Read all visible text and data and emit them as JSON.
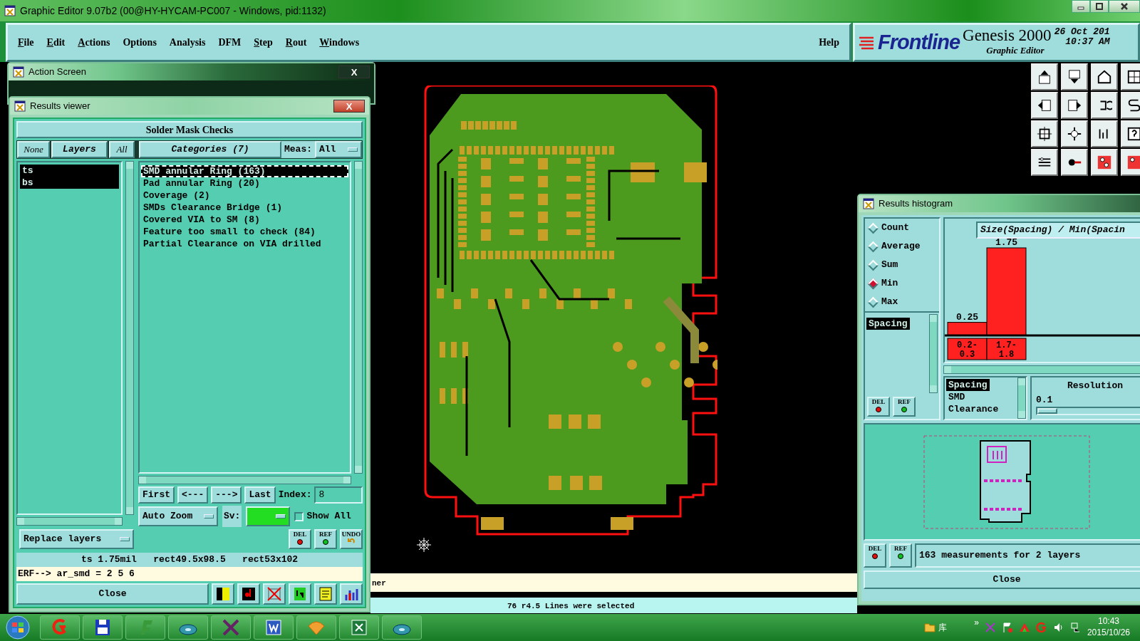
{
  "window": {
    "title": "Graphic Editor 9.07b2 (00@HY-HYCAM-PC007 - Windows, pid:1132)"
  },
  "menu": [
    {
      "label": "File",
      "underlined": true
    },
    {
      "label": "Edit",
      "underlined": true
    },
    {
      "label": "Actions",
      "underlined": true
    },
    {
      "label": "Options",
      "underlined": false
    },
    {
      "label": "Analysis",
      "underlined": false
    },
    {
      "label": "DFM",
      "underlined": false
    },
    {
      "label": "Step",
      "underlined": true
    },
    {
      "label": "Rout",
      "underlined": true
    },
    {
      "label": "Windows",
      "underlined": true
    }
  ],
  "help": "Help",
  "brand": {
    "logo": "Frontline",
    "product": "Genesis 2000",
    "subtitle": "Graphic Editor",
    "date": "26 Oct 201",
    "time": "10:37 AM"
  },
  "action_screen": {
    "title": "Action Screen",
    "close": "X"
  },
  "results_viewer": {
    "title": "Results viewer",
    "close": "X",
    "heading": "Solder Mask Checks",
    "layer_buttons": [
      "None",
      "Layers",
      "All"
    ],
    "categories_button": "Categories (7)",
    "meas_label": "Meas:",
    "meas_value": "All",
    "layers": [
      {
        "name": "ts",
        "selected": true
      },
      {
        "name": "bs",
        "selected": true
      }
    ],
    "categories": [
      {
        "label": "SMD annular Ring (163)",
        "selected": true
      },
      {
        "label": "Pad annular Ring (20)",
        "selected": false
      },
      {
        "label": "Coverage (2)",
        "selected": false
      },
      {
        "label": "SMDs Clearance Bridge (1)",
        "selected": false
      },
      {
        "label": "Covered VIA to SM (8)",
        "selected": false
      },
      {
        "label": "Feature too small to check (84)",
        "selected": false
      },
      {
        "label": "Partial Clearance on VIA drilled",
        "selected": false
      }
    ],
    "nav_buttons": [
      "First",
      "<---",
      "--->",
      "Last"
    ],
    "index_label": "Index:",
    "index_value": "8",
    "zoom_mode": "Auto Zoom",
    "sv_label": "Sv:",
    "show_all": {
      "label": "Show All",
      "checked": false
    },
    "action_buttons": [
      "DEL",
      "REF",
      "UNDO"
    ],
    "replace_mode": "Replace layers",
    "measurement": "ts 1.75mil   rect49.5x98.5   rect53x102",
    "erf_line": "ERF--> ar_smd = 2 5 6",
    "close_button": "Close"
  },
  "histogram": {
    "title": "Results histogram",
    "modes": [
      {
        "label": "Count",
        "selected": false
      },
      {
        "label": "Average",
        "selected": false
      },
      {
        "label": "Sum",
        "selected": false
      },
      {
        "label": "Min",
        "selected": true
      },
      {
        "label": "Max",
        "selected": false
      }
    ],
    "attributes": [
      {
        "label": "Spacing",
        "selected": true
      }
    ],
    "side_buttons": [
      "DEL",
      "REF"
    ],
    "chart_data": {
      "type": "bar",
      "title": "Size(Spacing) / Min(Spacin",
      "categories": [
        "0.2-0.3",
        "1.7-1.8"
      ],
      "series": [
        {
          "color": "#ff2020",
          "values": [
            0.25,
            1.75
          ]
        }
      ],
      "data_labels": true
    },
    "types": [
      {
        "label": "Spacing",
        "selected": true
      },
      {
        "label": "SMD",
        "selected": false
      },
      {
        "label": "Clearance",
        "selected": false
      }
    ],
    "resolution_label": "Resolution",
    "resolution_value": "0.1",
    "footer_buttons": [
      "DEL",
      "REF"
    ],
    "summary": "163 measurements for 2 layers",
    "close_button": "Close"
  },
  "message": "ner",
  "status_bar": "76 r4.5 Lines were selected",
  "taskbar": {
    "tray_label": "库",
    "overflow": "»",
    "time": "10:43",
    "date": "2015/10/26"
  }
}
